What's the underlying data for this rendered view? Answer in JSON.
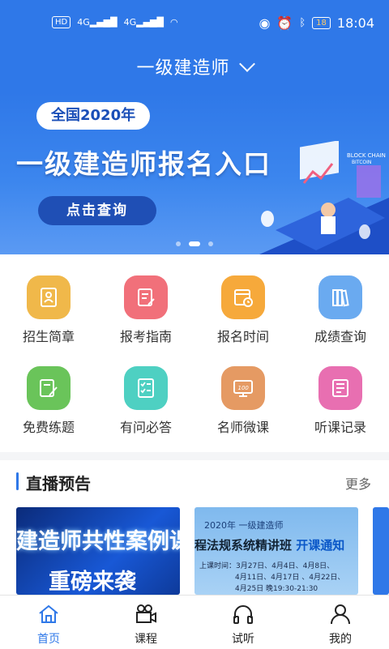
{
  "status_bar": {
    "left_items": [
      "HD",
      "4G",
      "4G"
    ],
    "battery": "18",
    "time": "18:04"
  },
  "header": {
    "title": "一级建造师"
  },
  "banner": {
    "tag": "全国2020年",
    "title": "一级建造师报名入口",
    "button": "点击查询",
    "illustration_text": [
      "BLOCK CHAIN",
      "BITCOIN"
    ],
    "dots": 3,
    "active_dot": 1
  },
  "menu": [
    {
      "label": "招生简章",
      "icon": "profile-card-icon",
      "color": "#f0b84a"
    },
    {
      "label": "报考指南",
      "icon": "document-edit-icon",
      "color": "#f1707a"
    },
    {
      "label": "报名时间",
      "icon": "calendar-clock-icon",
      "color": "#f6a93b"
    },
    {
      "label": "成绩查询",
      "icon": "books-icon",
      "color": "#6aaaf0"
    },
    {
      "label": "免费练题",
      "icon": "pencil-note-icon",
      "color": "#6ac45a"
    },
    {
      "label": "有问必答",
      "icon": "checklist-icon",
      "color": "#4ed0c2"
    },
    {
      "label": "名师微课",
      "icon": "monitor-100-icon",
      "color": "#e59a63"
    },
    {
      "label": "听课记录",
      "icon": "record-book-icon",
      "color": "#e86fb1"
    }
  ],
  "live": {
    "title": "直播预告",
    "more": "更多",
    "card1": {
      "line1": "建造师共性案例课",
      "line2": "重磅来袭"
    },
    "card2": {
      "line1": "2020年    一级建造师",
      "line2_main": "程法规系统精讲班",
      "line2_hl": " 开课通知",
      "line3": "上课时间：3月27日、4月4日、4月8日、",
      "line4": "4月11日、4月17日 、4月22日、",
      "line5": "4月25日   晚19:30-21:30"
    }
  },
  "tabbar": [
    {
      "label": "首页",
      "icon": "home-icon",
      "active": true
    },
    {
      "label": "课程",
      "icon": "video-camera-icon",
      "active": false
    },
    {
      "label": "试听",
      "icon": "headphones-icon",
      "active": false
    },
    {
      "label": "我的",
      "icon": "user-icon",
      "active": false
    }
  ],
  "colors": {
    "primary": "#2f78e8"
  }
}
